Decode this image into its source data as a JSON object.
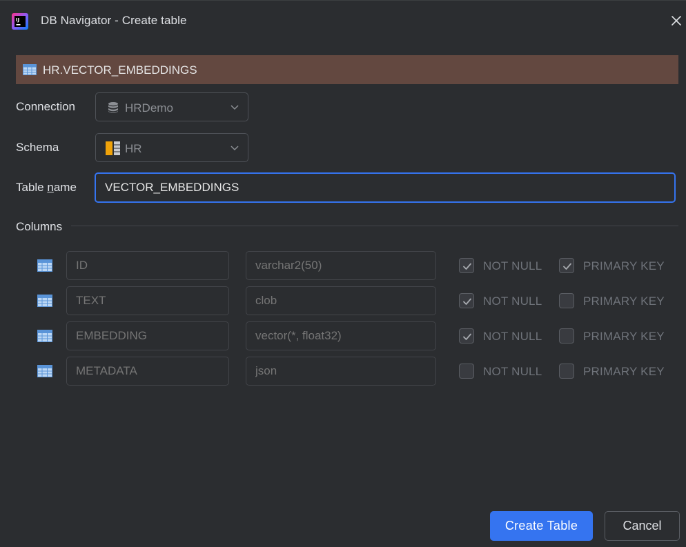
{
  "window": {
    "title": "DB Navigator - Create table",
    "logo_icon": "jetbrains-app-icon",
    "close_icon": "close-icon"
  },
  "banner": {
    "text": "HR.VECTOR_EMBEDDINGS",
    "icon": "table-icon",
    "background": "#634840"
  },
  "form": {
    "connection_label": "Connection",
    "connection_value": "HRDemo",
    "connection_icon": "database-icon",
    "schema_label": "Schema",
    "schema_value": "HR",
    "schema_icon": "schema-icon",
    "table_name_label_pre": "Table ",
    "table_name_label_mnemonic": "n",
    "table_name_label_post": "ame",
    "table_name_value": "VECTOR_EMBEDDINGS"
  },
  "columns": {
    "label": "Columns",
    "not_null_label": "NOT NULL",
    "primary_key_label": "PRIMARY KEY",
    "rows": [
      {
        "name": "ID",
        "type": "varchar2(50)",
        "not_null": true,
        "primary_key": true
      },
      {
        "name": "TEXT",
        "type": "clob",
        "not_null": true,
        "primary_key": false
      },
      {
        "name": "EMBEDDING",
        "type": "vector(*, float32)",
        "not_null": true,
        "primary_key": false
      },
      {
        "name": "METADATA",
        "type": "json",
        "not_null": false,
        "primary_key": false
      }
    ]
  },
  "buttons": {
    "create_label": "Create Table",
    "cancel_label": "Cancel"
  },
  "colors": {
    "accent": "#3574f0",
    "background": "#2b2d30"
  }
}
